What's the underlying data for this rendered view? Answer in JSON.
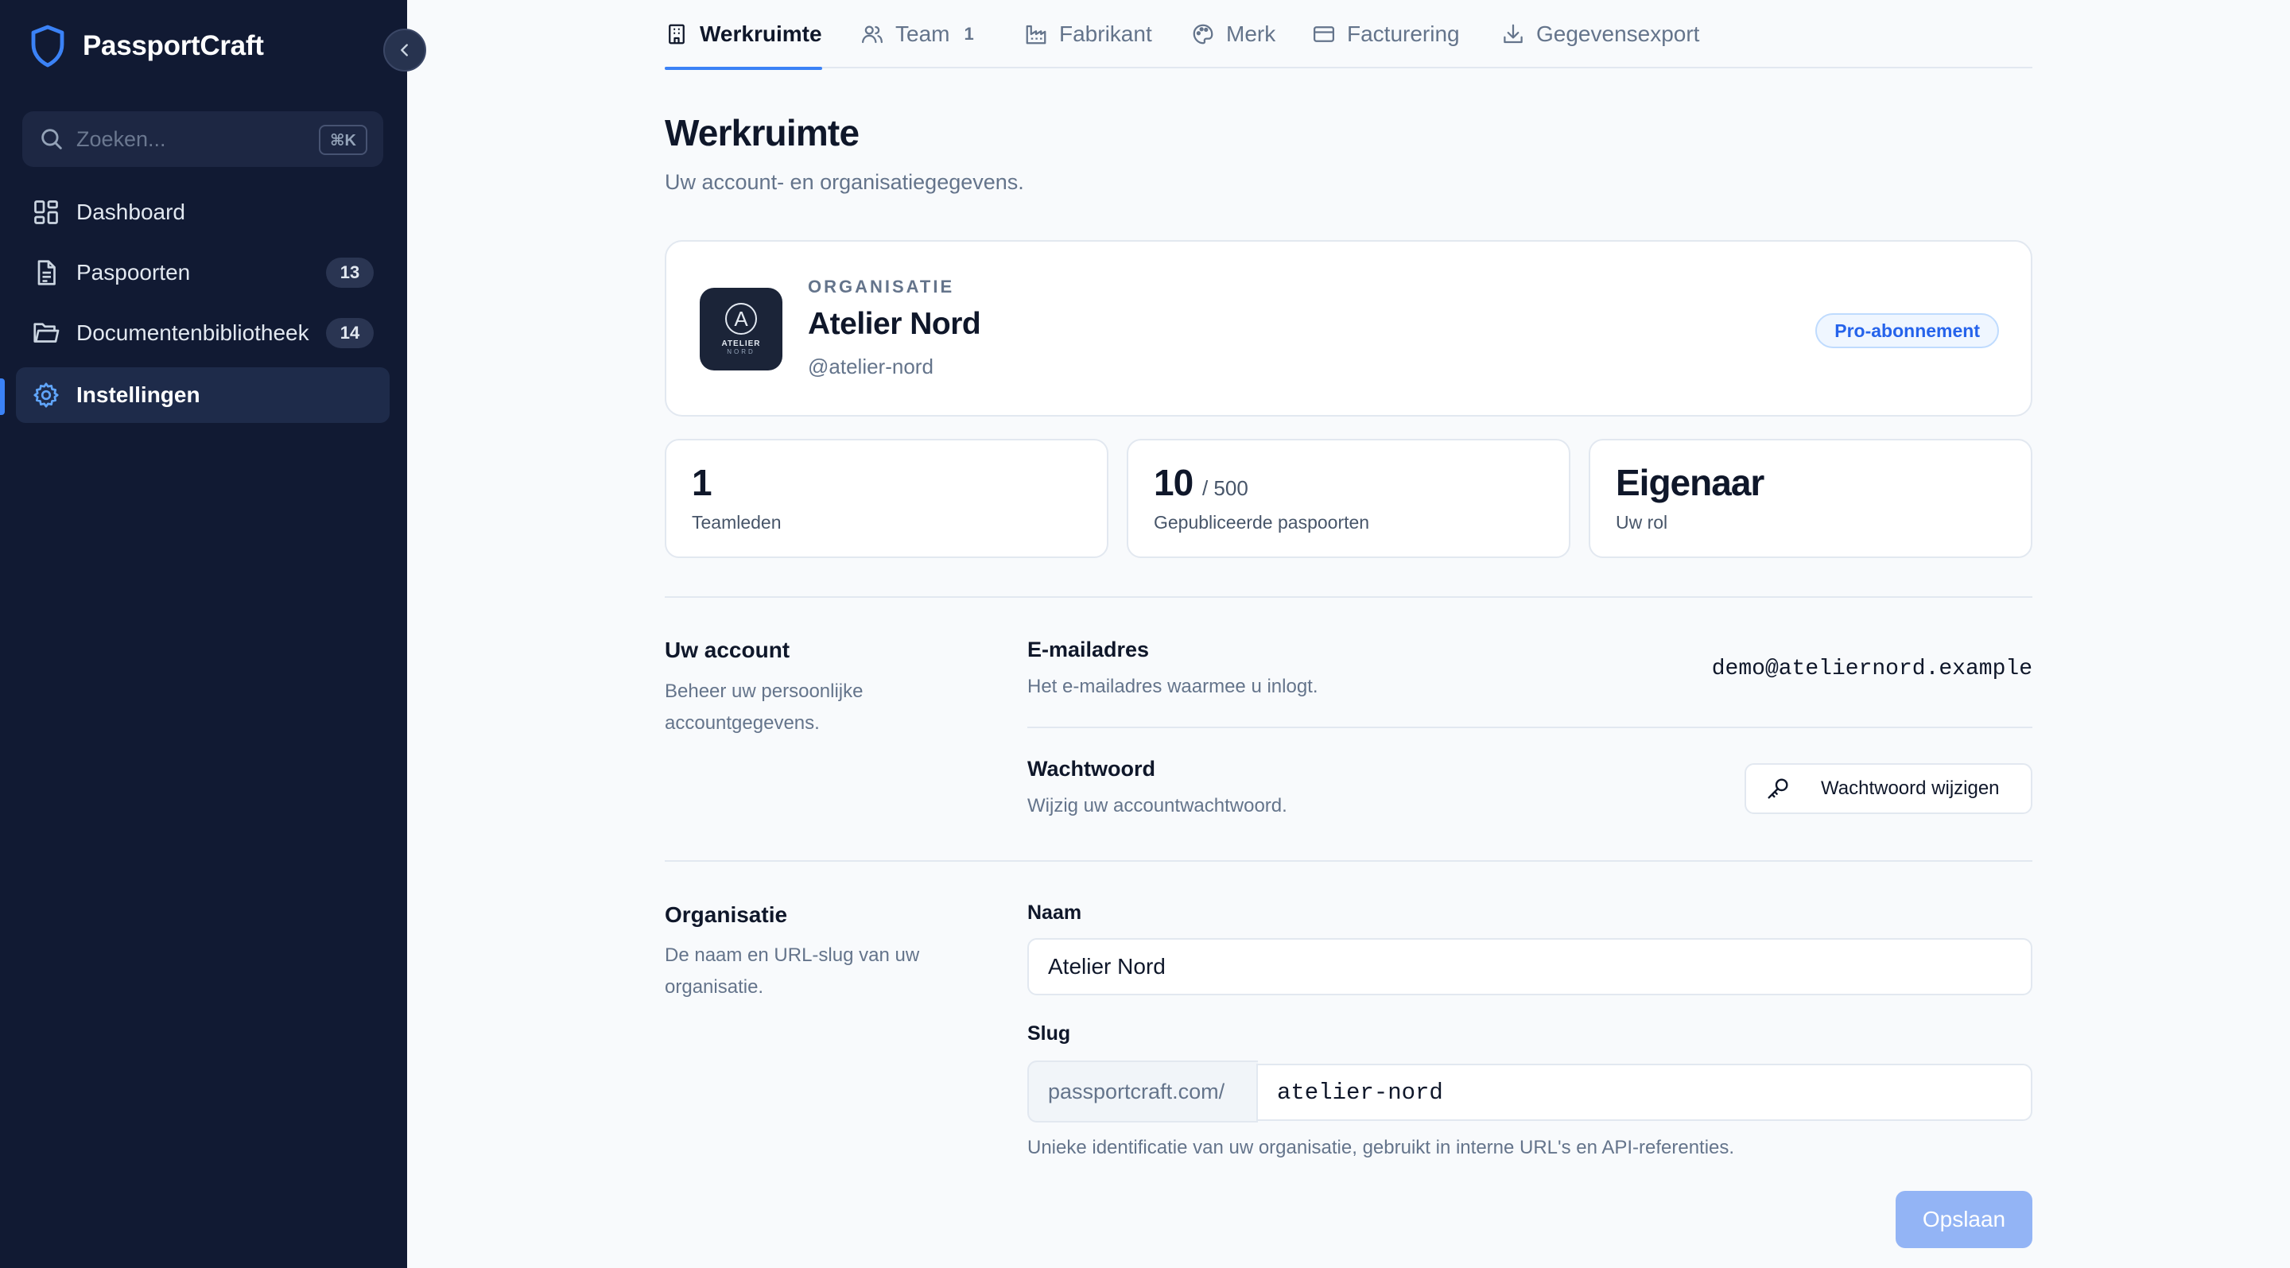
{
  "app": {
    "name": "PassportCraft"
  },
  "sidebar": {
    "search": {
      "placeholder": "Zoeken...",
      "shortcut": "⌘K"
    },
    "items": [
      {
        "label": "Dashboard",
        "icon": "grid-icon",
        "count": null
      },
      {
        "label": "Paspoorten",
        "icon": "document-icon",
        "count": "13"
      },
      {
        "label": "Documentenbibliotheek",
        "icon": "folder-icon",
        "count": "14"
      },
      {
        "label": "Instellingen",
        "icon": "gear-icon",
        "count": null,
        "active": true
      }
    ]
  },
  "tabs": [
    {
      "label": "Werkruimte",
      "icon": "building-icon",
      "active": true
    },
    {
      "label": "Team",
      "icon": "users-icon",
      "count": "1"
    },
    {
      "label": "Fabrikant",
      "icon": "factory-icon"
    },
    {
      "label": "Merk",
      "icon": "palette-icon"
    },
    {
      "label": "Facturering",
      "icon": "credit-card-icon"
    },
    {
      "label": "Gegevensexport",
      "icon": "download-icon"
    }
  ],
  "page": {
    "title": "Werkruimte",
    "subtitle": "Uw account- en organisatiegegevens."
  },
  "organization": {
    "eyebrow": "ORGANISATIE",
    "name": "Atelier Nord",
    "handle": "@atelier-nord",
    "plan": "Pro-abonnement",
    "logo": {
      "letter": "A",
      "line1": "ATELIER",
      "line2": "NORD"
    }
  },
  "stats": [
    {
      "value": "1",
      "suffix": "",
      "caption": "Teamleden"
    },
    {
      "value": "10",
      "suffix": "/ 500",
      "caption": "Gepubliceerde paspoorten"
    },
    {
      "value": "Eigenaar",
      "suffix": "",
      "caption": "Uw rol"
    }
  ],
  "account": {
    "title": "Uw account",
    "description": "Beheer uw persoonlijke accountgegevens.",
    "email_label": "E-mailadres",
    "email_help": "Het e-mailadres waarmee u inlogt.",
    "email_value": "demo@ateliernord.example",
    "password_label": "Wachtwoord",
    "password_help": "Wijzig uw accountwachtwoord.",
    "password_button": "Wachtwoord wijzigen"
  },
  "org_form": {
    "title": "Organisatie",
    "description": "De naam en URL-slug van uw organisatie.",
    "name_label": "Naam",
    "name_value": "Atelier Nord",
    "slug_label": "Slug",
    "slug_prefix": "passportcraft.com/",
    "slug_value": "atelier-nord",
    "slug_help": "Unieke identificatie van uw organisatie, gebruikt in interne URL's en API-referenties.",
    "save_label": "Opslaan"
  },
  "colors": {
    "sidebar_bg": "#111a33",
    "accent": "#3b82f6",
    "save_button": "#93b4f5"
  }
}
